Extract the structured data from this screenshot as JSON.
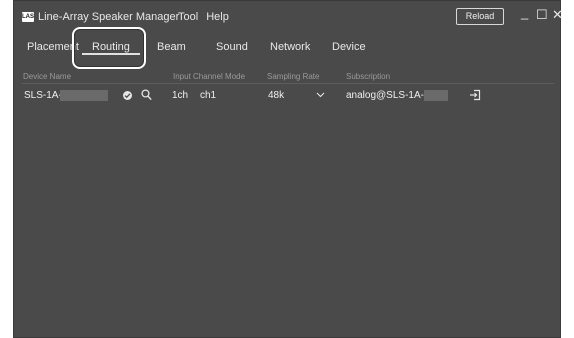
{
  "app": {
    "icon_text": "LAS",
    "title": "Line-Array Speaker Manager"
  },
  "menu": {
    "items": [
      "Tool",
      "Help"
    ]
  },
  "titlebar": {
    "reload_label": "Reload",
    "minimize_glyph": "_",
    "maximize_glyph": "☐",
    "close_glyph": "✕"
  },
  "tabs": [
    "Placement",
    "Routing",
    "Beam",
    "Sound",
    "Network",
    "Device"
  ],
  "active_tab": "Routing",
  "table": {
    "headers": [
      "Device Name",
      "Input Channel Mode",
      "Sampling Rate",
      "Subscription"
    ],
    "rows": [
      {
        "device_name": "SLS-1A-",
        "channel_count": "1ch",
        "channel": "ch1",
        "sampling_rate": "48k",
        "subscription": "analog@SLS-1A-"
      }
    ]
  },
  "icons": [
    "lasapp-icon",
    "check-circle-icon",
    "search-icon",
    "chevron-down-icon",
    "sign-in-icon"
  ]
}
